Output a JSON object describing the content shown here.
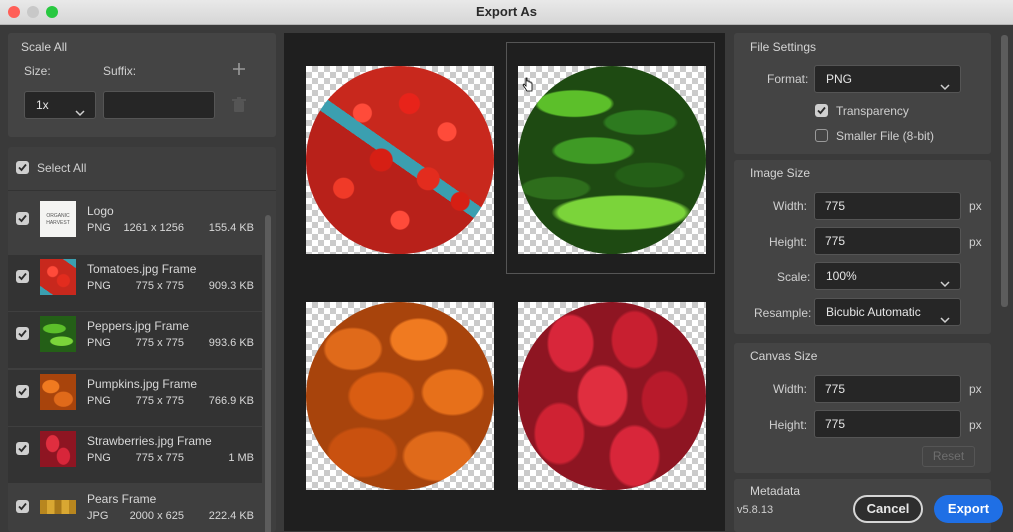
{
  "window": {
    "title": "Export As"
  },
  "scale_all": {
    "title": "Scale All",
    "size_label": "Size:",
    "suffix_label": "Suffix:",
    "size_value": "1x",
    "suffix_value": ""
  },
  "select_all": {
    "label": "Select All"
  },
  "assets": [
    {
      "name": "Logo",
      "format": "PNG",
      "dims": "1261 x 1256",
      "size": "155.4 KB",
      "checked": true,
      "thumb": "logo-thumbnail"
    },
    {
      "name": "Tomatoes.jpg Frame",
      "format": "PNG",
      "dims": "775 x 775",
      "size": "909.3 KB",
      "checked": true,
      "thumb": "tomatoes-thumbnail"
    },
    {
      "name": "Peppers.jpg Frame",
      "format": "PNG",
      "dims": "775 x 775",
      "size": "993.6 KB",
      "checked": true,
      "thumb": "peppers-thumbnail"
    },
    {
      "name": "Pumpkins.jpg Frame",
      "format": "PNG",
      "dims": "775 x 775",
      "size": "766.9 KB",
      "checked": true,
      "thumb": "pumpkins-thumbnail"
    },
    {
      "name": "Strawberries.jpg Frame",
      "format": "PNG",
      "dims": "775 x 775",
      "size": "1 MB",
      "checked": true,
      "thumb": "strawberries-thumbnail"
    },
    {
      "name": "Pears Frame",
      "format": "JPG",
      "dims": "2000 x 625",
      "size": "222.4 KB",
      "checked": true,
      "thumb": "pears-thumbnail"
    }
  ],
  "logo_thumb_text": [
    "ORGANIC",
    "HARVEST"
  ],
  "file_settings": {
    "title": "File Settings",
    "format_label": "Format:",
    "format_value": "PNG",
    "transparency_label": "Transparency",
    "transparency_checked": true,
    "smaller_file_label": "Smaller File (8-bit)",
    "smaller_file_checked": false
  },
  "image_size": {
    "title": "Image Size",
    "width_label": "Width:",
    "width_value": "775",
    "height_label": "Height:",
    "height_value": "775",
    "unit": "px",
    "scale_label": "Scale:",
    "scale_value": "100%",
    "resample_label": "Resample:",
    "resample_value": "Bicubic Automatic"
  },
  "canvas_size": {
    "title": "Canvas Size",
    "width_label": "Width:",
    "width_value": "775",
    "height_label": "Height:",
    "height_value": "775",
    "unit": "px",
    "reset_label": "Reset"
  },
  "metadata": {
    "title": "Metadata"
  },
  "footer": {
    "version": "v5.8.13",
    "cancel_label": "Cancel",
    "export_label": "Export"
  },
  "colors": {
    "accent": "#1f6fe5",
    "dialog_bg": "#3a3a3a",
    "panel_bg": "#444444"
  },
  "icons": [
    "close-window-icon",
    "minimize-window-icon",
    "maximize-window-icon",
    "plus-icon",
    "trash-icon",
    "chevron-down-icon",
    "checkmark-icon",
    "cursor-hand-icon"
  ]
}
